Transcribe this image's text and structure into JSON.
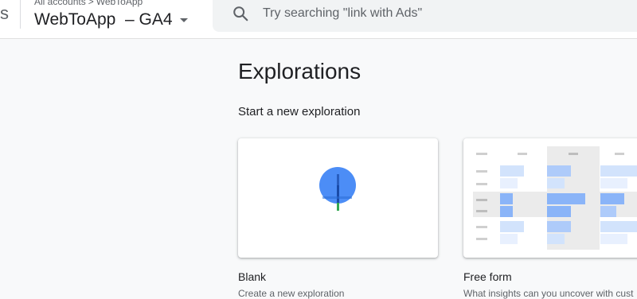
{
  "header": {
    "app_letter": "s",
    "breadcrumb": {
      "account": "All accounts",
      "property_crumb": "WebToApp"
    },
    "property_selector": "WebToApp  – GA4"
  },
  "search": {
    "placeholder": "Try searching \"link with Ads\""
  },
  "main": {
    "title": "Explorations",
    "section_title": "Start a new exploration",
    "templates": [
      {
        "title": "Blank",
        "description": "Create a new exploration"
      },
      {
        "title": "Free form",
        "description": "What insights can you uncover with cust"
      }
    ]
  },
  "colors": {
    "blue_light": "#d2e3fc",
    "blue_mid": "#aecbfa",
    "blue_strong": "#8ab4f8",
    "plus_circle": "#4c8df6",
    "plus_green": "#34a853"
  },
  "icons": {
    "search": "search-icon",
    "plus": "add-circle-icon",
    "caret": "caret-down-icon"
  }
}
